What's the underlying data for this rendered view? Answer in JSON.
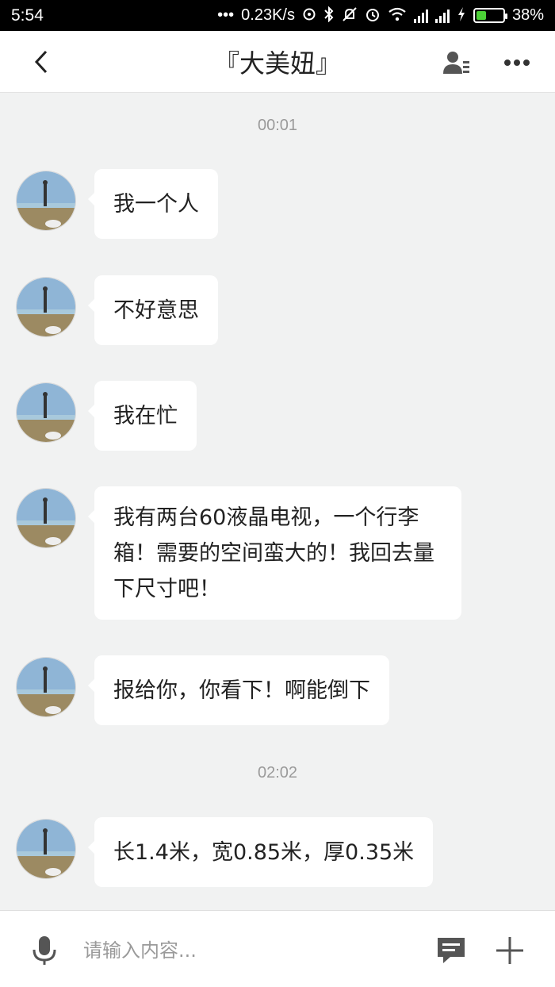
{
  "status_bar": {
    "time": "5:54",
    "dots": "•••",
    "net_speed": "0.23K/s",
    "battery": "38%",
    "battery_level": 0.38,
    "battery_color": "#4cd137"
  },
  "header": {
    "title": "『大美妞』",
    "back_icon": "chevron-left-icon",
    "contact_icon": "person-detail-icon",
    "more_icon": "more-dots-icon"
  },
  "messages": [
    {
      "type": "time",
      "text": "00:01"
    },
    {
      "type": "msg",
      "text": "我一个人"
    },
    {
      "type": "msg",
      "text": "不好意思"
    },
    {
      "type": "msg",
      "text": "我在忙"
    },
    {
      "type": "msg",
      "text": "我有两台60液晶电视，一个行李箱！需要的空间蛮大的！我回去量下尺寸吧！"
    },
    {
      "type": "msg",
      "text": "报给你，你看下！啊能倒下"
    },
    {
      "type": "time",
      "text": "02:02"
    },
    {
      "type": "msg",
      "text": "长1.4米，宽0.85米，厚0.35米"
    }
  ],
  "input_bar": {
    "placeholder": "请输入内容...",
    "mic_icon": "microphone-icon",
    "quick_reply_icon": "chat-bubble-icon",
    "plus_icon": "plus-icon"
  },
  "colors": {
    "background": "#f1f2f2",
    "bubble": "#ffffff",
    "icon": "#555555"
  }
}
